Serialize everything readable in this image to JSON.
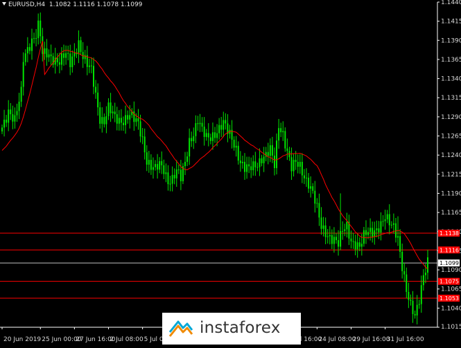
{
  "header": {
    "symbol": "EURUSD,H4",
    "ohlc": "1.1082 1.1116 1.1078 1.1099"
  },
  "watermark": {
    "text": "instaforex"
  },
  "colors": {
    "background": "#000000",
    "candles": "#00e600",
    "moving_average": "#ff0000",
    "level_lines": "#ff0000",
    "current_price_line": "#c0c0c0",
    "axis": "#ffffff"
  },
  "chart_data": {
    "type": "candlestick",
    "title": "",
    "ylim": [
      1.1015,
      1.144
    ],
    "y_ticks": [
      "1.1440",
      "1.1415",
      "1.1390",
      "1.1365",
      "1.1340",
      "1.1315",
      "1.1290",
      "1.1265",
      "1.1240",
      "1.1215",
      "1.1190",
      "1.1165",
      "1.1140",
      "1.1115",
      "1.1090",
      "1.1065",
      "1.1040",
      "1.1015"
    ],
    "x_ticks": [
      {
        "label": "20 Jun 2019",
        "bar": 0
      },
      {
        "label": "25 Jun 00:00",
        "bar": 18
      },
      {
        "label": "27 Jun 16:00",
        "bar": 34
      },
      {
        "label": "2 Jul 08:00",
        "bar": 50
      },
      {
        "label": "5 Jul 00:00",
        "bar": 66
      },
      {
        "label": "19 Jul 16:00",
        "bar": 132
      },
      {
        "label": "24 Jul 08:00",
        "bar": 148
      },
      {
        "label": "29 Jul 16:00",
        "bar": 164
      },
      {
        "label": "31 Jul 16:00",
        "bar": 180
      }
    ],
    "levels": [
      {
        "value": 1.1138,
        "label": "1.1138"
      },
      {
        "value": 1.1116,
        "label": "1.1116"
      },
      {
        "value": 1.1075,
        "label": "1.1075"
      },
      {
        "value": 1.1053,
        "label": "1.1053"
      }
    ],
    "current_price": {
      "value": 1.1099,
      "label": "1.1099"
    },
    "ma_period": 20,
    "anchors": [
      [
        0,
        1.1276
      ],
      [
        3,
        1.13
      ],
      [
        6,
        1.1285
      ],
      [
        9,
        1.132
      ],
      [
        10,
        1.1365
      ],
      [
        12,
        1.138
      ],
      [
        14,
        1.1392
      ],
      [
        16,
        1.1398
      ],
      [
        17,
        1.1408
      ],
      [
        18,
        1.1395
      ],
      [
        19,
        1.137
      ],
      [
        21,
        1.1372
      ],
      [
        24,
        1.1368
      ],
      [
        27,
        1.1362
      ],
      [
        30,
        1.137
      ],
      [
        32,
        1.136
      ],
      [
        34,
        1.1375
      ],
      [
        36,
        1.1388
      ],
      [
        38,
        1.1368
      ],
      [
        40,
        1.1356
      ],
      [
        42,
        1.135
      ],
      [
        44,
        1.132
      ],
      [
        46,
        1.129
      ],
      [
        48,
        1.1284
      ],
      [
        50,
        1.13
      ],
      [
        53,
        1.1288
      ],
      [
        56,
        1.1286
      ],
      [
        60,
        1.1292
      ],
      [
        62,
        1.1285
      ],
      [
        64,
        1.128
      ],
      [
        66,
        1.1262
      ],
      [
        68,
        1.1235
      ],
      [
        70,
        1.1225
      ],
      [
        72,
        1.122
      ],
      [
        74,
        1.1226
      ],
      [
        76,
        1.1222
      ],
      [
        78,
        1.1208
      ],
      [
        80,
        1.121
      ],
      [
        82,
        1.1218
      ],
      [
        84,
        1.1208
      ],
      [
        86,
        1.123
      ],
      [
        88,
        1.126
      ],
      [
        90,
        1.127
      ],
      [
        92,
        1.1285
      ],
      [
        94,
        1.127
      ],
      [
        96,
        1.1262
      ],
      [
        98,
        1.1265
      ],
      [
        100,
        1.127
      ],
      [
        102,
        1.1275
      ],
      [
        104,
        1.128
      ],
      [
        106,
        1.127
      ],
      [
        108,
        1.1262
      ],
      [
        110,
        1.125
      ],
      [
        112,
        1.1232
      ],
      [
        114,
        1.1222
      ],
      [
        116,
        1.122
      ],
      [
        118,
        1.1225
      ],
      [
        120,
        1.123
      ],
      [
        122,
        1.1238
      ],
      [
        124,
        1.124
      ],
      [
        126,
        1.1245
      ],
      [
        128,
        1.1225
      ],
      [
        130,
        1.128
      ],
      [
        132,
        1.127
      ],
      [
        134,
        1.1245
      ],
      [
        136,
        1.1222
      ],
      [
        138,
        1.1228
      ],
      [
        140,
        1.1225
      ],
      [
        142,
        1.1214
      ],
      [
        144,
        1.1205
      ],
      [
        146,
        1.119
      ],
      [
        148,
        1.1168
      ],
      [
        150,
        1.1145
      ],
      [
        152,
        1.114
      ],
      [
        154,
        1.1135
      ],
      [
        156,
        1.113
      ],
      [
        158,
        1.1122
      ],
      [
        160,
        1.114
      ],
      [
        162,
        1.1148
      ],
      [
        164,
        1.113
      ],
      [
        166,
        1.1125
      ],
      [
        168,
        1.1118
      ],
      [
        170,
        1.1132
      ],
      [
        172,
        1.114
      ],
      [
        174,
        1.1142
      ],
      [
        176,
        1.1145
      ],
      [
        178,
        1.1148
      ],
      [
        180,
        1.1156
      ],
      [
        182,
        1.115
      ],
      [
        184,
        1.1148
      ],
      [
        186,
        1.1135
      ],
      [
        188,
        1.1095
      ],
      [
        190,
        1.106
      ],
      [
        192,
        1.104
      ],
      [
        194,
        1.103
      ],
      [
        196,
        1.1055
      ],
      [
        198,
        1.1085
      ],
      [
        200,
        1.1099
      ]
    ]
  }
}
